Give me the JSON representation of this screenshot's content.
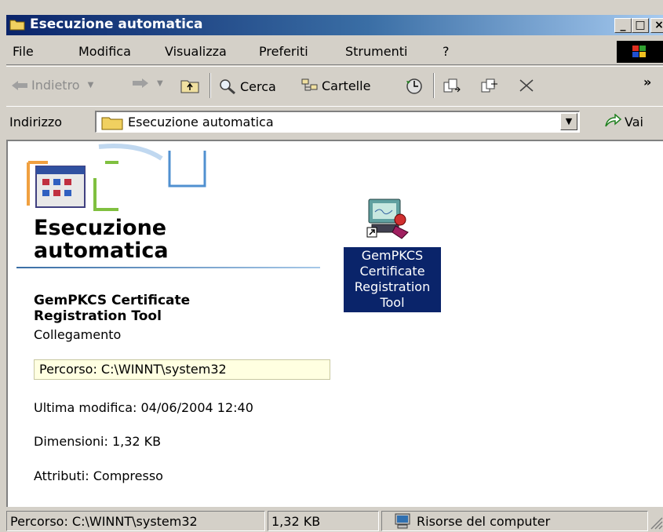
{
  "window": {
    "title": "Esecuzione automatica",
    "buttons": {
      "minimize": "_",
      "maximize": "□",
      "close": "×"
    }
  },
  "menu": [
    {
      "label": "File"
    },
    {
      "label": "Modifica"
    },
    {
      "label": "Visualizza"
    },
    {
      "label": "Preferiti"
    },
    {
      "label": "Strumenti"
    },
    {
      "label": "?"
    }
  ],
  "toolbar": {
    "back": "Indietro",
    "search": "Cerca",
    "folders": "Cartelle",
    "more": "»"
  },
  "address": {
    "label": "Indirizzo",
    "value": "Esecuzione automatica",
    "go": "Vai"
  },
  "panel": {
    "title_line1": "Esecuzione",
    "title_line2": "automatica",
    "item_name_line1": "GemPKCS Certificate",
    "item_name_line2": "Registration Tool",
    "item_type": "Collegamento",
    "path": "Percorso: C:\\WINNT\\system32",
    "modified": "Ultima modifica: 04/06/2004 12:40",
    "size": "Dimensioni: 1,32 KB",
    "attributes": "Attributi: Compresso"
  },
  "file": {
    "label_lines": [
      "GemPKCS",
      "Certificate",
      "Registration",
      "Tool"
    ]
  },
  "status": {
    "path": "Percorso: C:\\WINNT\\system32",
    "size": "1,32 KB",
    "zone": "Risorse del computer"
  }
}
